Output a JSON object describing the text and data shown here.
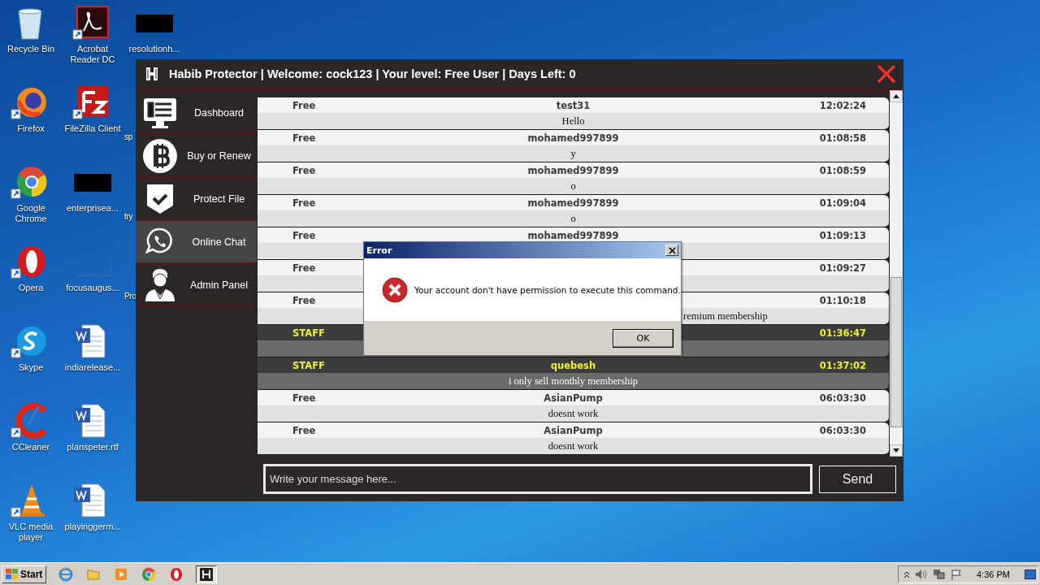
{
  "desktop": {
    "icons": [
      {
        "label": "Recycle Bin",
        "kind": "bin"
      },
      {
        "label": "Firefox",
        "kind": "firefox"
      },
      {
        "label": "Google Chrome",
        "kind": "chrome"
      },
      {
        "label": "Opera",
        "kind": "opera"
      },
      {
        "label": "Skype",
        "kind": "skype"
      },
      {
        "label": "CCleaner",
        "kind": "ccleaner"
      },
      {
        "label": "VLC media player",
        "kind": "vlc"
      },
      {
        "label": "Acrobat Reader DC",
        "kind": "pdf"
      },
      {
        "label": "FileZilla Client",
        "kind": "filezilla"
      },
      {
        "label": "enterprisea...",
        "kind": "redacted"
      },
      {
        "label": "focusaugus...",
        "kind": "blank"
      },
      {
        "label": "indiarelease...",
        "kind": "word"
      },
      {
        "label": "planspeter.rtf",
        "kind": "word"
      },
      {
        "label": "playinggerm...",
        "kind": "word"
      },
      {
        "label": "resolutionh...",
        "kind": "redacted"
      },
      {
        "label": "sp",
        "kind": "hidden"
      },
      {
        "label": "try",
        "kind": "hidden"
      },
      {
        "label": "Pro",
        "kind": "hidden"
      }
    ]
  },
  "window": {
    "title": "Habib Protector | Welcome: cock123 | Your level: Free User | Days Left: 0",
    "sidebar": {
      "items": [
        {
          "label": "Dashboard",
          "kind": "monitor",
          "selected": false
        },
        {
          "label": "Buy or Renew",
          "kind": "coin",
          "selected": false
        },
        {
          "label": "Protect File",
          "kind": "shield",
          "selected": false
        },
        {
          "label": "Online Chat",
          "kind": "chat",
          "selected": true
        },
        {
          "label": "Admin Panel",
          "kind": "person",
          "selected": false
        }
      ]
    },
    "chat": {
      "messages": [
        {
          "kind": "free",
          "rank": "Free",
          "user": "test31",
          "time": "12:02:24",
          "text": "Hello"
        },
        {
          "kind": "free",
          "rank": "Free",
          "user": "mohamed997899",
          "time": "01:08:58",
          "text": "y"
        },
        {
          "kind": "free",
          "rank": "Free",
          "user": "mohamed997899",
          "time": "01:08:59",
          "text": "o"
        },
        {
          "kind": "free",
          "rank": "Free",
          "user": "mohamed997899",
          "time": "01:09:04",
          "text": "o"
        },
        {
          "kind": "free",
          "rank": "Free",
          "user": "mohamed997899",
          "time": "01:09:13"
        },
        {
          "kind": "free",
          "rank": "Free",
          "time": "01:09:27"
        },
        {
          "kind": "free",
          "rank": "Free",
          "time": "01:10:18",
          "text": "remium membership",
          "text_cut": true
        },
        {
          "kind": "staff",
          "rank": "STAFF",
          "time": "01:36:47"
        },
        {
          "kind": "staff",
          "rank": "STAFF",
          "user": "quebesh",
          "time": "01:37:02",
          "text": "i only sell monthly membership"
        },
        {
          "kind": "free",
          "rank": "Free",
          "user": "AsianPump",
          "time": "06:03:30",
          "text": "doesnt work"
        },
        {
          "kind": "free",
          "rank": "Free",
          "user": "AsianPump",
          "time": "06:03:30",
          "text": "doesnt work"
        }
      ],
      "input": {
        "placeholder": "Write your message here..."
      },
      "send_button": "Send"
    }
  },
  "dialog": {
    "title": "Error",
    "message": "Your account don't have permission to execute this command.",
    "button": "OK"
  },
  "taskbar": {
    "start": "Start",
    "apps": [
      {
        "kind": "ie",
        "active": false
      },
      {
        "kind": "folder",
        "active": false
      },
      {
        "kind": "media",
        "active": false
      },
      {
        "kind": "chrome",
        "active": false
      },
      {
        "kind": "opera",
        "active": false
      },
      {
        "kind": "habib",
        "active": true
      }
    ],
    "time": "4:36 PM"
  }
}
